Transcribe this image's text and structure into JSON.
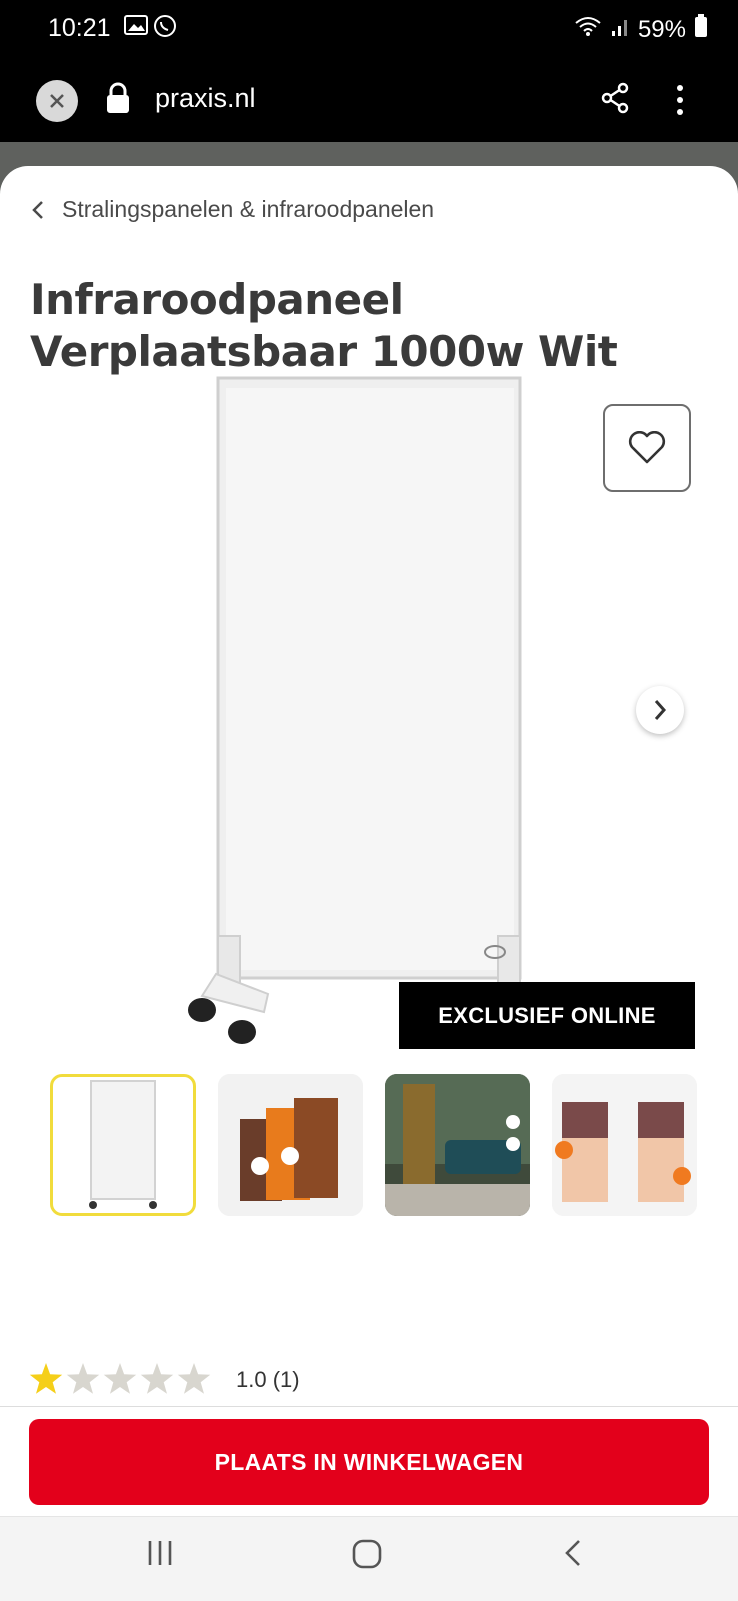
{
  "status_bar": {
    "time": "10:21",
    "battery": "59%"
  },
  "browser": {
    "url": "praxis.nl"
  },
  "breadcrumb": {
    "label": "Stralingspanelen & infraroodpanelen"
  },
  "product": {
    "title": "Infraroodpaneel Verplaatsbaar 1000w Wit",
    "badge": "EXCLUSIEF ONLINE",
    "rating": "1.0 (1)",
    "rating_value": 1,
    "rating_max": 5
  },
  "thumbnails": [
    {
      "name": "thumbnail-white-panel",
      "selected": true
    },
    {
      "name": "thumbnail-printed-panels",
      "selected": false
    },
    {
      "name": "thumbnail-living-room",
      "selected": false
    },
    {
      "name": "thumbnail-wallpaper-panels",
      "selected": false
    }
  ],
  "cta": {
    "label": "PLAATS IN WINKELWAGEN"
  },
  "colors": {
    "accent": "#e3001b",
    "selected_thumb_border": "#f1dc3c",
    "star_filled": "#f5cf19",
    "star_empty": "#d8d6cf"
  }
}
